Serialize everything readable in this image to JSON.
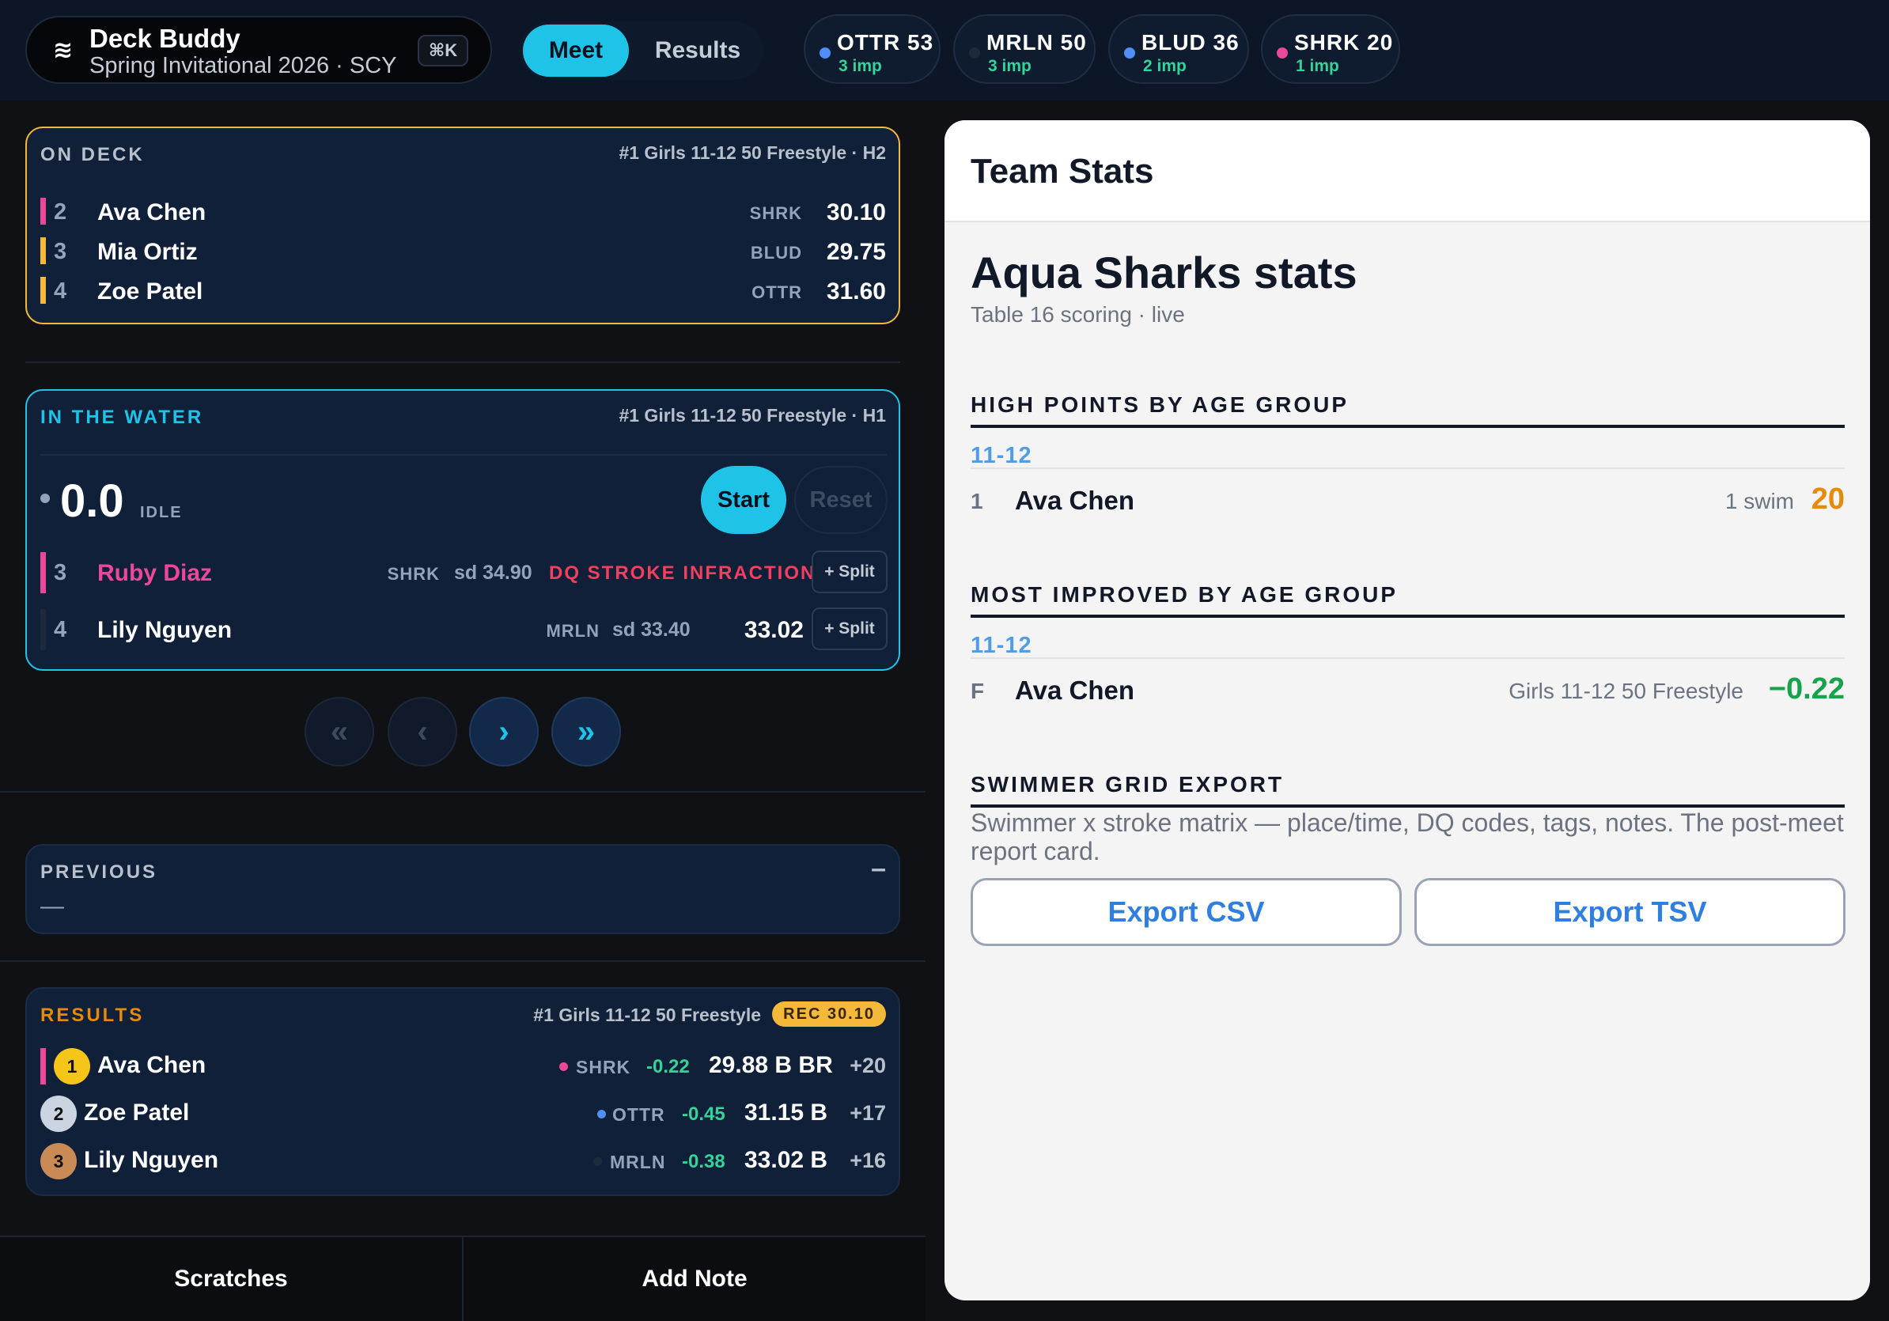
{
  "app": {
    "logo_glyph": "≋",
    "name": "Deck Buddy",
    "meet": "Spring Invitational 2026 · SCY",
    "shortcut": "⌘K"
  },
  "nav": {
    "tab_meet": "Meet",
    "tab_results": "Results",
    "active": "Meet"
  },
  "teams": [
    {
      "code": "OTTR",
      "score": "53",
      "imp": "3 imp",
      "color": "#4f8ff7"
    },
    {
      "code": "MRLN",
      "score": "50",
      "imp": "3 imp",
      "color": "#1e293b"
    },
    {
      "code": "BLUD",
      "score": "36",
      "imp": "2 imp",
      "color": "#4f8ff7"
    },
    {
      "code": "SHRK",
      "score": "20",
      "imp": "1 imp",
      "color": "#ec4899"
    }
  ],
  "on_deck": {
    "label": "ON DECK",
    "event": "#1 Girls 11-12 50 Freestyle · H2",
    "rows": [
      {
        "lane": "2",
        "name": "Ava Chen",
        "team": "SHRK",
        "seed": "30.10",
        "bar_color": "#ec4899"
      },
      {
        "lane": "3",
        "name": "Mia Ortiz",
        "team": "BLUD",
        "seed": "29.75",
        "bar_color": "#f5b93a"
      },
      {
        "lane": "4",
        "name": "Zoe Patel",
        "team": "OTTR",
        "seed": "31.60",
        "bar_color": "#f5b93a"
      }
    ]
  },
  "in_water": {
    "label": "IN THE WATER",
    "event": "#1 Girls 11-12 50 Freestyle · H1",
    "clock": "0.0",
    "status": "IDLE",
    "start_label": "Start",
    "reset_label": "Reset",
    "rows": [
      {
        "lane": "3",
        "name": "Ruby Diaz",
        "team": "SHRK",
        "seed": "sd 34.90",
        "result": "DQ STROKE INFRACTION",
        "split_label": "+ Split",
        "dq": true
      },
      {
        "lane": "4",
        "name": "Lily Nguyen",
        "team": "MRLN",
        "seed": "sd 33.40",
        "result": "33.02",
        "split_label": "+ Split",
        "dq": false
      }
    ]
  },
  "pager": {
    "first": "«",
    "prev": "‹",
    "next": "›",
    "last": "»"
  },
  "previous": {
    "label": "PREVIOUS",
    "collapse": "–",
    "value": "—"
  },
  "results": {
    "label": "RESULTS",
    "event": "#1 Girls 11-12 50 Freestyle",
    "record_badge": "REC 30.10",
    "rows": [
      {
        "place": "1",
        "name": "Ava Chen",
        "team": "SHRK",
        "team_color": "#ec4899",
        "delta": "-0.22",
        "time": "29.88 B BR",
        "points": "+20"
      },
      {
        "place": "2",
        "name": "Zoe Patel",
        "team": "OTTR",
        "team_color": "#4f8ff7",
        "delta": "-0.45",
        "time": "31.15 B",
        "points": "+17"
      },
      {
        "place": "3",
        "name": "Lily Nguyen",
        "team": "MRLN",
        "team_color": "#1e293b",
        "delta": "-0.38",
        "time": "33.02 B",
        "points": "+16"
      }
    ]
  },
  "footer": {
    "scratches": "Scratches",
    "add_note": "Add Note"
  },
  "stats": {
    "panel_title": "Team Stats",
    "heading": "Aqua Sharks stats",
    "subheading": "Table 16 scoring · live",
    "high_points": {
      "title": "HIGH POINTS BY AGE GROUP",
      "age_group": "11-12",
      "rank": "1",
      "name": "Ava Chen",
      "meta": "1 swim",
      "value": "20"
    },
    "most_improved": {
      "title": "MOST IMPROVED BY AGE GROUP",
      "age_group": "11-12",
      "rank": "F",
      "name": "Ava Chen",
      "meta": "Girls 11-12 50 Freestyle",
      "value": "−0.22"
    },
    "export": {
      "title": "SWIMMER GRID EXPORT",
      "description": "Swimmer x stroke matrix — place/time, DQ codes, tags, notes. The post-meet report card.",
      "csv_label": "Export CSV",
      "tsv_label": "Export TSV"
    }
  },
  "colors": {
    "accent_cyan": "#20c3e8",
    "on_deck_border": "#f5b93a",
    "dq_red": "#f43f5e",
    "improve_green": "#16a34a",
    "points_orange": "#e58a0a"
  }
}
